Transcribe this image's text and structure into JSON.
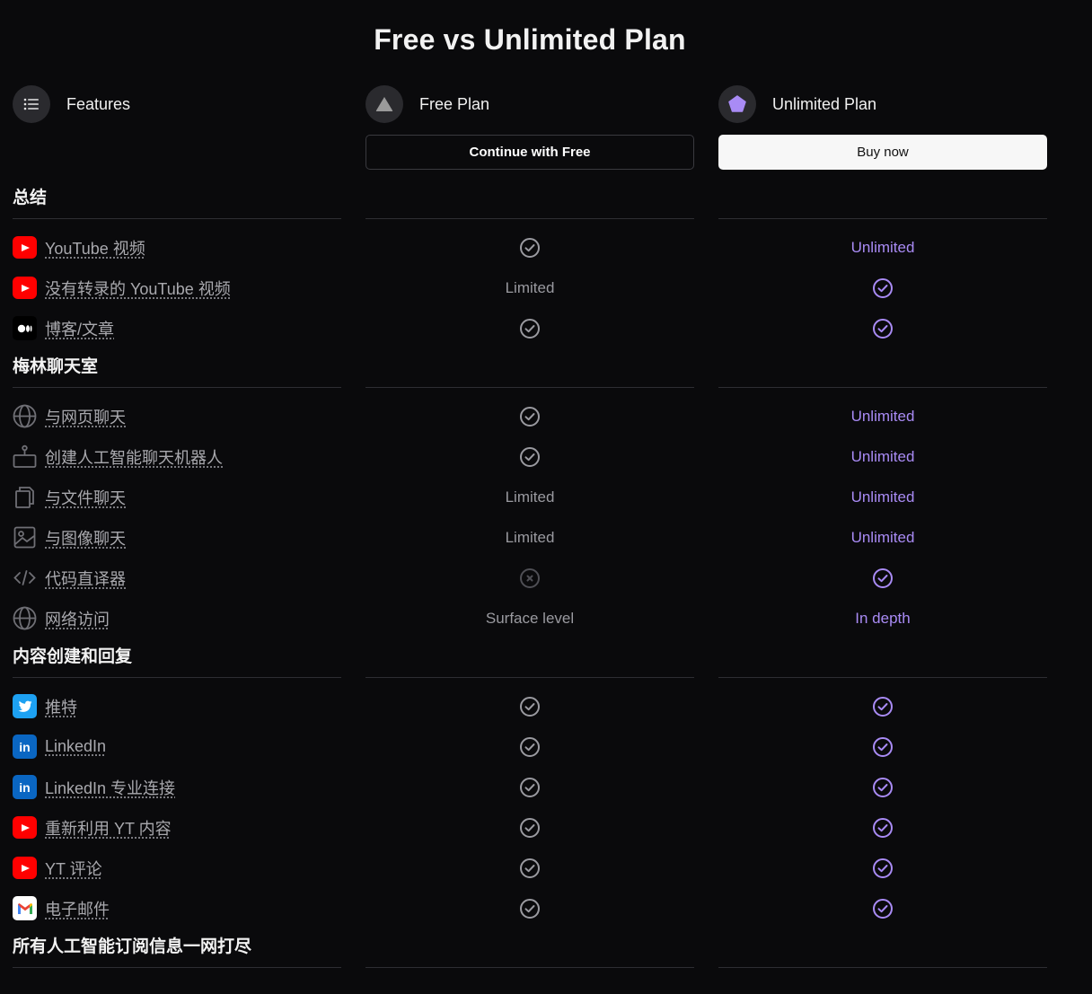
{
  "page": {
    "title": "Free vs Unlimited Plan"
  },
  "columns": {
    "features": {
      "label": "Features",
      "icon": "list-icon"
    },
    "free": {
      "label": "Free Plan",
      "icon": "triangle-icon",
      "button": "Continue with Free"
    },
    "unlimited": {
      "label": "Unlimited Plan",
      "icon": "pentagon-icon",
      "button": "Buy now",
      "accent": "#a98bf5"
    }
  },
  "sections": [
    {
      "title": "总结",
      "rows": [
        {
          "label": "YouTube 视频",
          "icon": "youtube-icon",
          "free": "check",
          "unl": "Unlimited"
        },
        {
          "label": "没有转录的 YouTube 视频",
          "icon": "youtube-icon",
          "free": "Limited",
          "unl": "check"
        },
        {
          "label": "博客/文章",
          "icon": "medium-icon",
          "free": "check",
          "unl": "check"
        }
      ]
    },
    {
      "title": "梅林聊天室",
      "rows": [
        {
          "label": "与网页聊天",
          "icon": "globe-icon",
          "free": "check",
          "unl": "Unlimited"
        },
        {
          "label": "创建人工智能聊天机器人",
          "icon": "robot-icon",
          "free": "check",
          "unl": "Unlimited"
        },
        {
          "label": "与文件聊天",
          "icon": "files-icon",
          "free": "Limited",
          "unl": "Unlimited"
        },
        {
          "label": "与图像聊天",
          "icon": "image-icon",
          "free": "Limited",
          "unl": "Unlimited"
        },
        {
          "label": "代码直译器",
          "icon": "code-icon",
          "free": "cross",
          "unl": "check"
        },
        {
          "label": "网络访问",
          "icon": "globe-icon",
          "free": "Surface level",
          "unl": "In depth"
        }
      ]
    },
    {
      "title": "内容创建和回复",
      "rows": [
        {
          "label": "推特",
          "icon": "twitter-icon",
          "free": "check",
          "unl": "check"
        },
        {
          "label": "LinkedIn",
          "icon": "linkedin-icon",
          "free": "check",
          "unl": "check"
        },
        {
          "label": "LinkedIn 专业连接",
          "icon": "linkedin-icon",
          "free": "check",
          "unl": "check"
        },
        {
          "label": "重新利用 YT 内容",
          "icon": "youtube-icon",
          "free": "check",
          "unl": "check"
        },
        {
          "label": "YT 评论",
          "icon": "youtube-icon",
          "free": "check",
          "unl": "check"
        },
        {
          "label": "电子邮件",
          "icon": "gmail-icon",
          "free": "check",
          "unl": "check"
        }
      ]
    },
    {
      "title": "所有人工智能订阅信息一网打尽",
      "rows": []
    }
  ]
}
